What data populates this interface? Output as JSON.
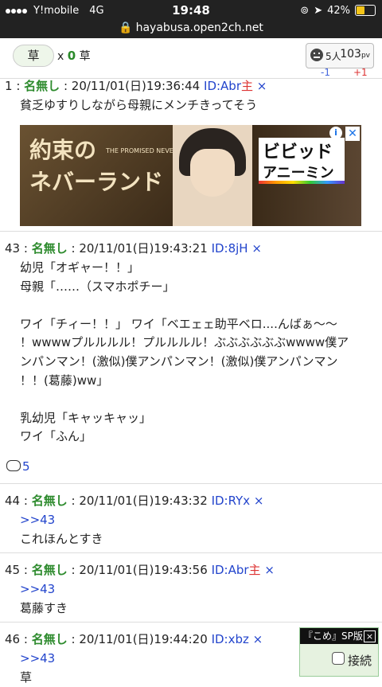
{
  "status": {
    "carrier": "Y!mobile",
    "network": "4G",
    "time": "19:48",
    "battery": "42%",
    "battery_level": 0.42
  },
  "url": "hayabusa.open2ch.net",
  "toolbar": {
    "grass_label": "草",
    "grass_x": "x",
    "grass_count": "0",
    "grass_unit": "草",
    "people": "5人",
    "pv": "103",
    "pv_unit": "pv",
    "delta_minus": "-1",
    "delta_plus": "+1"
  },
  "ad": {
    "title_line1": "約束の",
    "title_line2": "ネバーランド",
    "subtitle": "THE PROMISED NEVERLAND",
    "logo_line1": "ビビッド",
    "logo_line2": "アニーミン",
    "info": "i",
    "close": "✕"
  },
  "posts": [
    {
      "num": "1",
      "name": "名無し",
      "date": "20/11/01(日)19:36:44",
      "id": "ID:Abr",
      "owner": "主",
      "x": "×",
      "lines": [
        "貧乏ゆすりしながら母親にメンチきってそう"
      ]
    },
    {
      "num": "43",
      "name": "名無し",
      "date": "20/11/01(日)19:43:21",
      "id": "ID:8jH",
      "owner": "",
      "x": "×",
      "lines": [
        "幼児「オギャー！！」",
        "母親「……（スマホポチー」",
        "",
        "ワイ「チィー！！」 ワイ「ベエェェ助平ベロ....んばぁ〜〜",
        "！wwwwプルルルル！プルルルル！ぶぶぶぶぶぶwwww僕ア",
        "ンパンマン！(激似)僕アンパンマン！(激似)僕アンパンマン",
        "！！(葛藤)ww」",
        "",
        "乳幼児「キャッキャッ」",
        "ワイ「ふん」"
      ],
      "reply_count": "5"
    },
    {
      "num": "44",
      "name": "名無し",
      "date": "20/11/01(日)19:43:32",
      "id": "ID:RYx",
      "owner": "",
      "x": "×",
      "anchor": ">>43",
      "lines": [
        "これほんとすき"
      ]
    },
    {
      "num": "45",
      "name": "名無し",
      "date": "20/11/01(日)19:43:56",
      "id": "ID:Abr",
      "owner": "主",
      "x": "×",
      "anchor": ">>43",
      "lines": [
        "葛藤すき"
      ]
    },
    {
      "num": "46",
      "name": "名無し",
      "date": "20/11/01(日)19:44:20",
      "id": "ID:xbz",
      "owner": "",
      "x": "×",
      "anchor": ">>43",
      "lines": [
        "草"
      ]
    }
  ],
  "sp_box": {
    "title": "『こめ』SP版",
    "close": "×",
    "connect_label": "接続"
  }
}
